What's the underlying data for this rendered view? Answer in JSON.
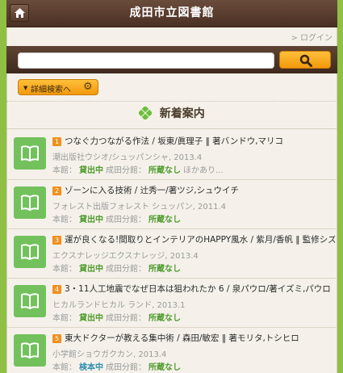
{
  "header": {
    "title": "成田市立図書館"
  },
  "login": {
    "label": "> ログイン"
  },
  "search": {
    "placeholder": ""
  },
  "advanced": {
    "label": "詳細検索へ"
  },
  "section": {
    "title": "新着案内"
  },
  "items": [
    {
      "num": "1",
      "title": "つなぐ力つながる作法 / 坂東/眞理子 ‖ 著バンドウ,マリコ",
      "publisher": "潮出版社ウシオ/シュッパンシャ, 2013.4",
      "honkan_label": "本館：",
      "honkan": "貸出中",
      "narita_label": "成田分館：",
      "narita": "所蔵なし",
      "more": "ほかあり..."
    },
    {
      "num": "2",
      "title": "ゾーンに入る技術 / 辻秀一/著ツジ,シュウイチ",
      "publisher": "フォレスト出版フォレスト シュッパン, 2011.4",
      "honkan_label": "本館：",
      "honkan": "貸出中",
      "narita_label": "成田分館：",
      "narita": "所蔵なし",
      "more": ""
    },
    {
      "num": "3",
      "title": "運が良くなる!間取りとインテリアのHAPPY風水 / 紫月/香帆 ‖ 監修シズキ,カホ",
      "publisher": "エクスナレッジエクスナレッジ, 2013.4",
      "honkan_label": "本館：",
      "honkan": "貸出中",
      "narita_label": "成田分館：",
      "narita": "所蔵なし",
      "more": ""
    },
    {
      "num": "4",
      "title": "3・11人工地震でなぜ日本は狙われたか 6 / 泉パウロ/著イズミ,パウロ",
      "publisher": "ヒカルランドヒカル ランド, 2013.1",
      "honkan_label": "本館：",
      "honkan": "貸出中",
      "narita_label": "成田分館：",
      "narita": "所蔵なし",
      "more": ""
    },
    {
      "num": "5",
      "title": "東大ドクターが教える集中術 / 森田/敏宏 ‖ 著モリタ,トシヒロ",
      "publisher": "小学館ショウガクカン, 2013.4",
      "honkan_label": "本館：",
      "honkan": "検本中",
      "narita_label": "成田分館：",
      "narita": "所蔵なし",
      "more": ""
    }
  ]
}
